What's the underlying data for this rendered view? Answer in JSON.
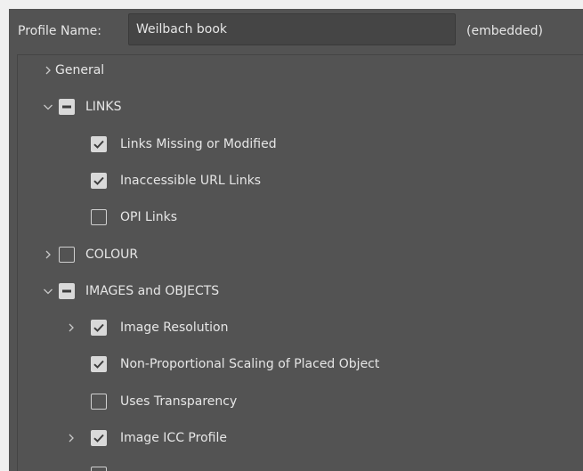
{
  "header": {
    "profile_label": "Profile Name:",
    "profile_value": "Weilbach book",
    "embedded_label": "(embedded)"
  },
  "tree": [
    {
      "label": "General",
      "chevron": "right",
      "checkbox": "none",
      "level": 0
    },
    {
      "label": "LINKS",
      "chevron": "down",
      "checkbox": "mixed",
      "level": 0
    },
    {
      "label": "Links Missing or Modified",
      "chevron": "none",
      "checkbox": "checked",
      "level": 1
    },
    {
      "label": "Inaccessible URL Links",
      "chevron": "none",
      "checkbox": "checked",
      "level": 1
    },
    {
      "label": "OPI Links",
      "chevron": "none",
      "checkbox": "unchecked",
      "level": 1
    },
    {
      "label": "COLOUR",
      "chevron": "right",
      "checkbox": "unchecked",
      "level": 0
    },
    {
      "label": "IMAGES and OBJECTS",
      "chevron": "down",
      "checkbox": "mixed",
      "level": 0
    },
    {
      "label": "Image Resolution",
      "chevron": "right",
      "checkbox": "checked",
      "level": 1
    },
    {
      "label": "Non-Proportional Scaling of Placed Object",
      "chevron": "none",
      "checkbox": "checked",
      "level": 1
    },
    {
      "label": "Uses Transparency",
      "chevron": "none",
      "checkbox": "unchecked",
      "level": 1
    },
    {
      "label": "Image ICC Profile",
      "chevron": "right",
      "checkbox": "checked",
      "level": 1
    },
    {
      "label": "",
      "chevron": "none",
      "checkbox": "unchecked",
      "level": 1
    }
  ]
}
